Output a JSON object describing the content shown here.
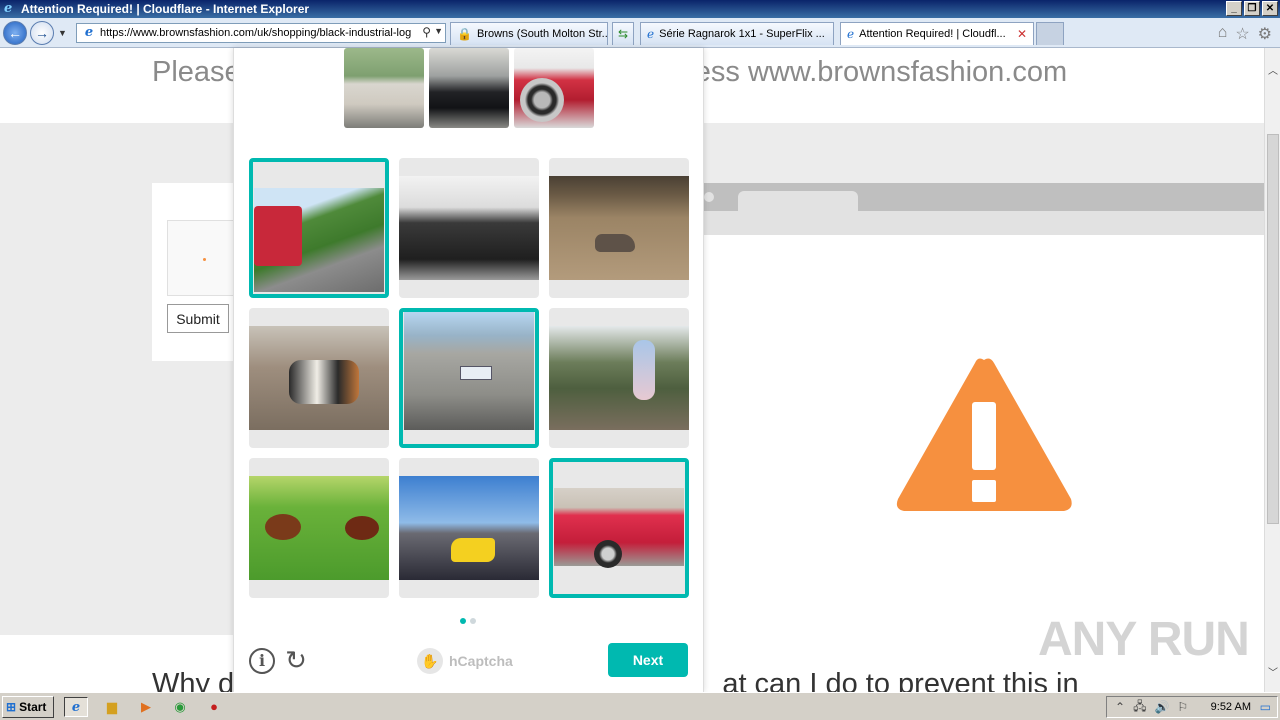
{
  "window": {
    "title": "Attention Required! | Cloudflare - Internet Explorer",
    "controls": [
      "_",
      "❐",
      "✕"
    ]
  },
  "nav": {
    "url": "https://www.brownsfashion.com/uk/shopping/black-industrial-log",
    "tabs": [
      {
        "label": "Browns (South Molton Str..."
      },
      {
        "label": "Série Ragnarok 1x1 - SuperFlix ..."
      },
      {
        "label": "Attention Required! | Cloudfl..."
      }
    ]
  },
  "page": {
    "top_message": "Please … ess www.brownsfashion.com",
    "top_left": "Please",
    "top_right": "ess www.brownsfashion.com",
    "submit_label": "Submit",
    "bottom_left": "Why d",
    "bottom_right": "at can I do to prevent this in"
  },
  "challenge": {
    "examples": [
      {
        "icon": "white-car-image"
      },
      {
        "icon": "black-car-image"
      },
      {
        "icon": "red-car-wheel-image"
      }
    ],
    "tiles": [
      {
        "icon": "red-bus-road-image",
        "selected": true
      },
      {
        "icon": "car-engine-image",
        "selected": false
      },
      {
        "icon": "cat-on-floor-image",
        "selected": false
      },
      {
        "icon": "dogs-image",
        "selected": false
      },
      {
        "icon": "silver-suv-image",
        "selected": true
      },
      {
        "icon": "person-on-bicycle-image",
        "selected": false
      },
      {
        "icon": "roosters-image",
        "selected": false
      },
      {
        "icon": "motorcycles-image",
        "selected": false
      },
      {
        "icon": "red-convertible-image",
        "selected": true
      }
    ],
    "page_dots": 2,
    "active_dot": 0,
    "logo_text": "hCaptcha",
    "next_label": "Next",
    "accent_color": "#00b9b0"
  },
  "warning_color": "#f6903f",
  "watermark": "ANY RUN",
  "taskbar": {
    "start_label": "Start",
    "clock": "9:52 AM"
  }
}
